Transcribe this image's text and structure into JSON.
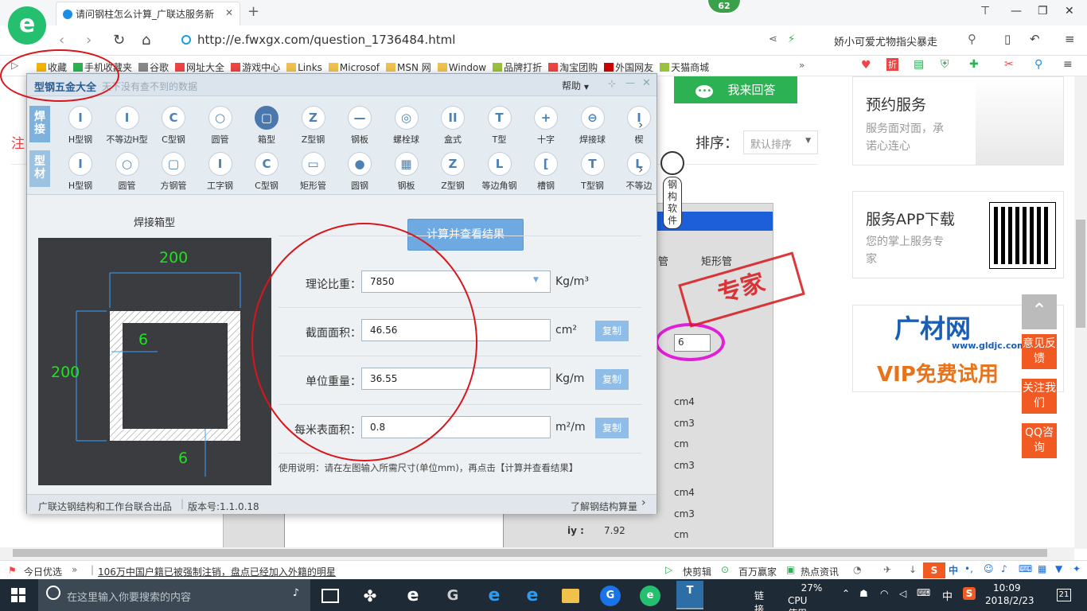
{
  "browser": {
    "tab_title": "请问钢柱怎么计算_广联达服务新",
    "badge": "62",
    "url": "http://e.fwxgx.com/question_1736484.html",
    "search_text": "娇小可爱尤物指尖暴走",
    "bookmarks": [
      "收藏",
      "手机收藏夹",
      "谷歌",
      "网址大全",
      "游戏中心",
      "Links",
      "Microsof",
      "MSN 网",
      "Window",
      "品牌打折",
      "淘宝团购",
      "外国网友",
      "天猫商城"
    ]
  },
  "page": {
    "answer_btn": "我来回答",
    "sort_label": "排序：",
    "sort_value": "默认排序",
    "left_char": "注",
    "card1": {
      "title": "预约服务",
      "desc1": "服务面对面，承",
      "desc2": "诺心连心"
    },
    "card2": {
      "title": "服务APP下载",
      "desc1": "您的掌上服务专",
      "desc2": "家"
    },
    "card3": {
      "brand": "广材网",
      "domain": "www.gldjc.com",
      "promo": "VIP免费试用"
    },
    "float_btns": [
      "意见反馈",
      "关注我们",
      "QQ咨询"
    ],
    "mascot_text": "钢构软件",
    "stamp": "专家",
    "bg_tabs": [
      "管",
      "矩形管"
    ],
    "bg_input": "6",
    "bg_units": [
      "cm4",
      "cm3",
      "cm",
      "cm3",
      "cm4",
      "cm3",
      "cm"
    ],
    "bg_iy_label": "iy :",
    "bg_iy_value": "7.92"
  },
  "dialog": {
    "title": "型钢五金大全",
    "subtitle": "天下没有查不到的数据",
    "help": "帮助",
    "side1": "焊接",
    "side2": "型材",
    "row1_tools": [
      "H型钢",
      "不等边H型",
      "C型钢",
      "圆管",
      "箱型",
      "Z型钢",
      "钢板",
      "螺栓球",
      "盒式",
      "T型",
      "十字",
      "焊接球",
      "楔"
    ],
    "row2_tools": [
      "H型钢",
      "圆管",
      "方钢管",
      "工字钢",
      "C型钢",
      "矩形管",
      "圆钢",
      "钢板",
      "Z型钢",
      "等边角钢",
      "槽钢",
      "T型钢",
      "不等边"
    ],
    "section_title": "焊接箱型",
    "dims": {
      "width": "200",
      "height": "200",
      "web": "6",
      "flange": "6"
    },
    "calc_btn": "计算并查看结果",
    "fields": [
      {
        "label": "理论比重：",
        "value": "7850",
        "unit": "Kg/m³",
        "copy": ""
      },
      {
        "label": "截面面积：",
        "value": "46.56",
        "unit": "cm²",
        "copy": "复制"
      },
      {
        "label": "单位重量：",
        "value": "36.55",
        "unit": "Kg/m",
        "copy": "复制"
      },
      {
        "label": "每米表面积：",
        "value": "0.8",
        "unit": "m²/m",
        "copy": "复制"
      }
    ],
    "usage": "使用说明：请在左图输入所需尺寸(单位mm)，再点击【计算并查看结果】",
    "footer_left": "广联达钢结构和工作台联合出品",
    "version": "版本号:1.1.0.18",
    "footer_link": "了解钢结构算量"
  },
  "status": {
    "left": "今日优选",
    "news": "106万中国户籍已被强制注销，盘点已经加入外籍的明星",
    "items": [
      "快剪辑",
      "百万赢家",
      "热点资讯"
    ]
  },
  "taskbar": {
    "search_placeholder": "在这里输入你要搜索的内容",
    "link_label": "链接",
    "cpu": "27%",
    "cpu_label": "CPU使用",
    "ime": "中",
    "time": "10:09",
    "date": "2018/2/23",
    "notif": "21"
  },
  "colors": {
    "accent": "#2db253",
    "dialog_blue": "#6fa9e2",
    "annotation_red": "#d8161b",
    "drawing_green": "#19e619"
  }
}
